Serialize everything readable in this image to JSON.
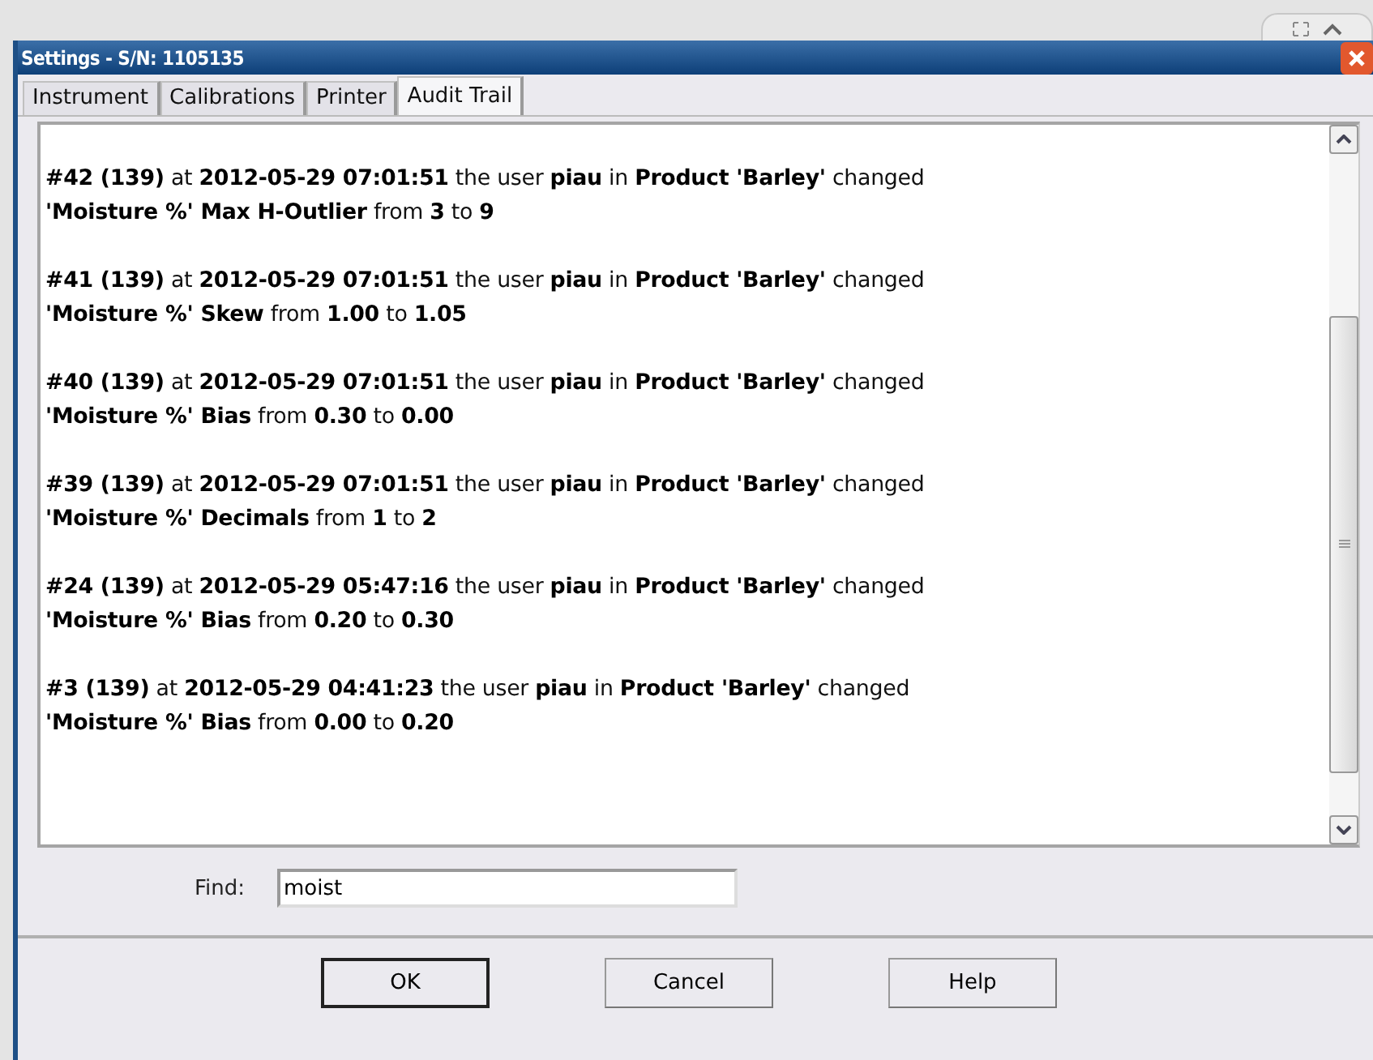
{
  "window": {
    "title": "Settings - S/N: 1105135"
  },
  "tabs": [
    {
      "label": "Instrument",
      "selected": false
    },
    {
      "label": "Calibrations",
      "selected": false
    },
    {
      "label": "Printer",
      "selected": false
    },
    {
      "label": "Audit Trail",
      "selected": true
    }
  ],
  "audit_entries": [
    {
      "lines": [
        "**#42 (139)** at **2012-05-29 07:01:51** the user **piau** in **Product 'Barley'** changed",
        "**'Moisture %' Max H-Outlier** from **3** to **9**"
      ]
    },
    {
      "lines": [
        "**#41 (139)** at **2012-05-29 07:01:51** the user **piau** in **Product 'Barley'** changed",
        "**'Moisture %' Skew** from **1.00** to **1.05**"
      ]
    },
    {
      "lines": [
        "**#40 (139)** at **2012-05-29 07:01:51** the user **piau** in **Product 'Barley'** changed",
        "**'Moisture %' Bias** from **0.30** to **0.00**"
      ]
    },
    {
      "lines": [
        "**#39 (139)** at **2012-05-29 07:01:51** the user **piau** in **Product 'Barley'** changed",
        "**'Moisture %' Decimals** from **1** to **2**"
      ]
    },
    {
      "lines": [
        "**#24 (139)** at **2012-05-29 05:47:16** the user **piau** in **Product 'Barley'** changed",
        "**'Moisture %' Bias** from **0.20** to **0.30**"
      ]
    },
    {
      "lines": [
        "**#3 (139)** at **2012-05-29 04:41:23** the user **piau** in **Product 'Barley'** changed",
        "**'Moisture %' Bias** from **0.00** to **0.20**"
      ]
    }
  ],
  "find": {
    "label": "Find:",
    "value": "moist"
  },
  "buttons": [
    {
      "label": "OK",
      "default": true
    },
    {
      "label": "Cancel",
      "default": false
    },
    {
      "label": "Help",
      "default": false
    }
  ]
}
